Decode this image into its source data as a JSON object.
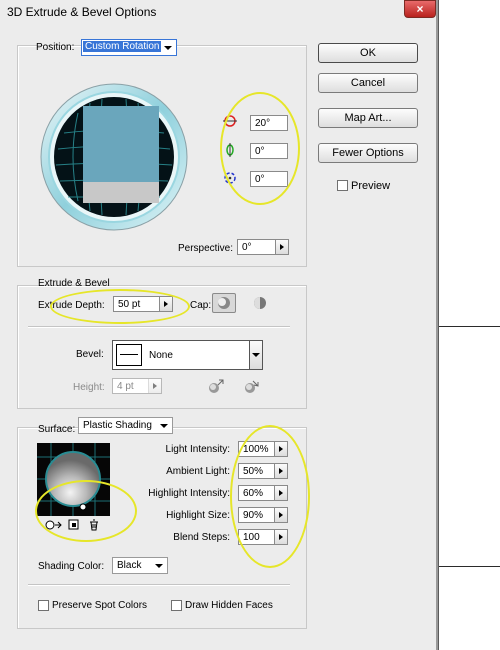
{
  "window": {
    "title": "3D Extrude & Bevel Options",
    "close_glyph": "×"
  },
  "position": {
    "label": "Position:",
    "value": "Custom Rotation",
    "perspective_label": "Perspective:",
    "perspective_value": "0°"
  },
  "rotation": {
    "x_value": "20°",
    "y_value": "0°",
    "z_value": "0°"
  },
  "buttons": {
    "ok": "OK",
    "cancel": "Cancel",
    "map_art": "Map Art...",
    "fewer_options": "Fewer Options",
    "preview": "Preview"
  },
  "extrude": {
    "section_title": "Extrude & Bevel",
    "depth_label": "Extrude Depth:",
    "depth_value": "50 pt",
    "cap_label": "Cap:",
    "bevel_label": "Bevel:",
    "bevel_value": "None",
    "height_label": "Height:",
    "height_value": "4 pt"
  },
  "surface": {
    "label": "Surface:",
    "value": "Plastic Shading",
    "fields": [
      {
        "label": "Light Intensity:",
        "value": "100%"
      },
      {
        "label": "Ambient Light:",
        "value": "50%"
      },
      {
        "label": "Highlight Intensity:",
        "value": "60%"
      },
      {
        "label": "Highlight Size:",
        "value": "90%"
      },
      {
        "label": "Blend Steps:",
        "value": "100"
      }
    ],
    "shading_color_label": "Shading Color:",
    "shading_color_value": "Black",
    "preserve_spot": "Preserve Spot Colors",
    "draw_hidden": "Draw Hidden Faces"
  },
  "colors": {
    "highlight_ellipse": "#e6e629",
    "dialog_bg": "#ececec",
    "cube_face": "#6aa6bc",
    "accent_blue": "#3875d7"
  }
}
